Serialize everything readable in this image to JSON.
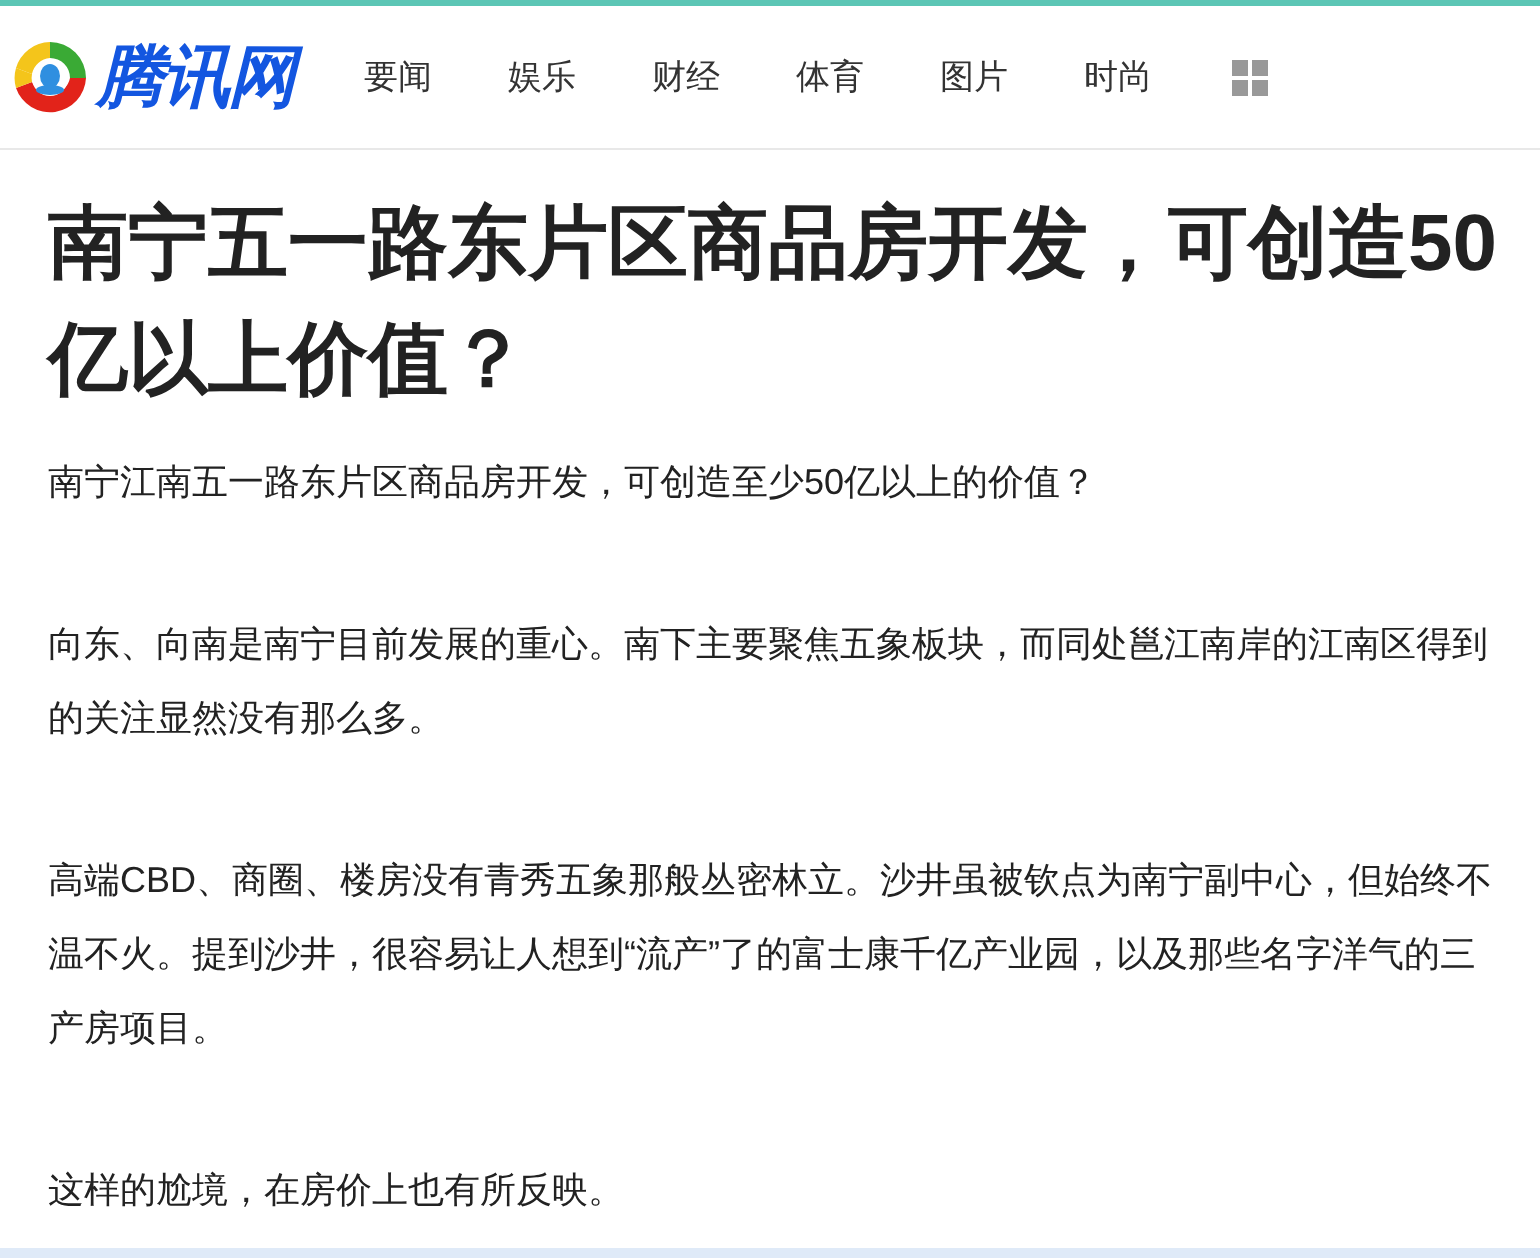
{
  "logo": {
    "text": "腾讯网"
  },
  "nav": [
    {
      "label": "要闻"
    },
    {
      "label": "娱乐"
    },
    {
      "label": "财经"
    },
    {
      "label": "体育"
    },
    {
      "label": "图片"
    },
    {
      "label": "时尚"
    }
  ],
  "article": {
    "title": "南宁五一路东片区商品房开发，可创造50亿以上价值？",
    "paragraphs": [
      "南宁江南五一路东片区商品房开发，可创造至少50亿以上的价值？",
      "向东、向南是南宁目前发展的重心。南下主要聚焦五象板块，而同处邕江南岸的江南区得到的关注显然没有那么多。",
      "高端CBD、商圈、楼房没有青秀五象那般丛密林立。沙井虽被钦点为南宁副中心，但始终不温不火。提到沙井，很容易让人想到“流产”了的富士康千亿产业园，以及那些名字洋气的三产房项目。",
      "这样的尬境，在房价上也有所反映。"
    ]
  }
}
